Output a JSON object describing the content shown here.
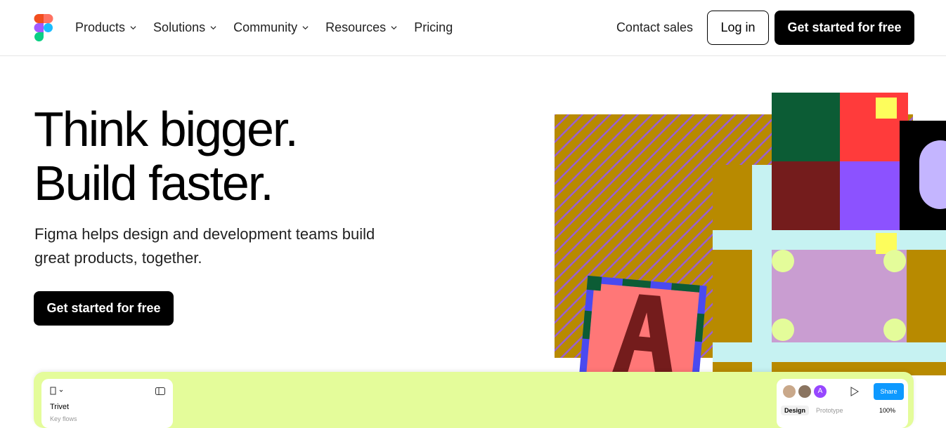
{
  "nav": {
    "logo": "figma-logo",
    "links": [
      {
        "label": "Products",
        "has_dropdown": true
      },
      {
        "label": "Solutions",
        "has_dropdown": true
      },
      {
        "label": "Community",
        "has_dropdown": true
      },
      {
        "label": "Resources",
        "has_dropdown": true
      },
      {
        "label": "Pricing",
        "has_dropdown": false
      }
    ],
    "contact_sales": "Contact sales",
    "login": "Log in",
    "cta": "Get started for free"
  },
  "hero": {
    "title_line1": "Think bigger.",
    "title_line2": "Build faster.",
    "subtitle": "Figma helps design and development teams build great products, together.",
    "cta": "Get started for free"
  },
  "editor_preview": {
    "left_panel": {
      "file_name": "Trivet",
      "sub": "Key flows"
    },
    "right_panel": {
      "avatar_letter": "A",
      "share_label": "Share",
      "tabs": [
        "Design",
        "Prototype"
      ],
      "zoom": "100%"
    }
  },
  "colors": {
    "panel": "#e4fc9a",
    "share": "#0d99ff",
    "gold": "#b88a00"
  }
}
